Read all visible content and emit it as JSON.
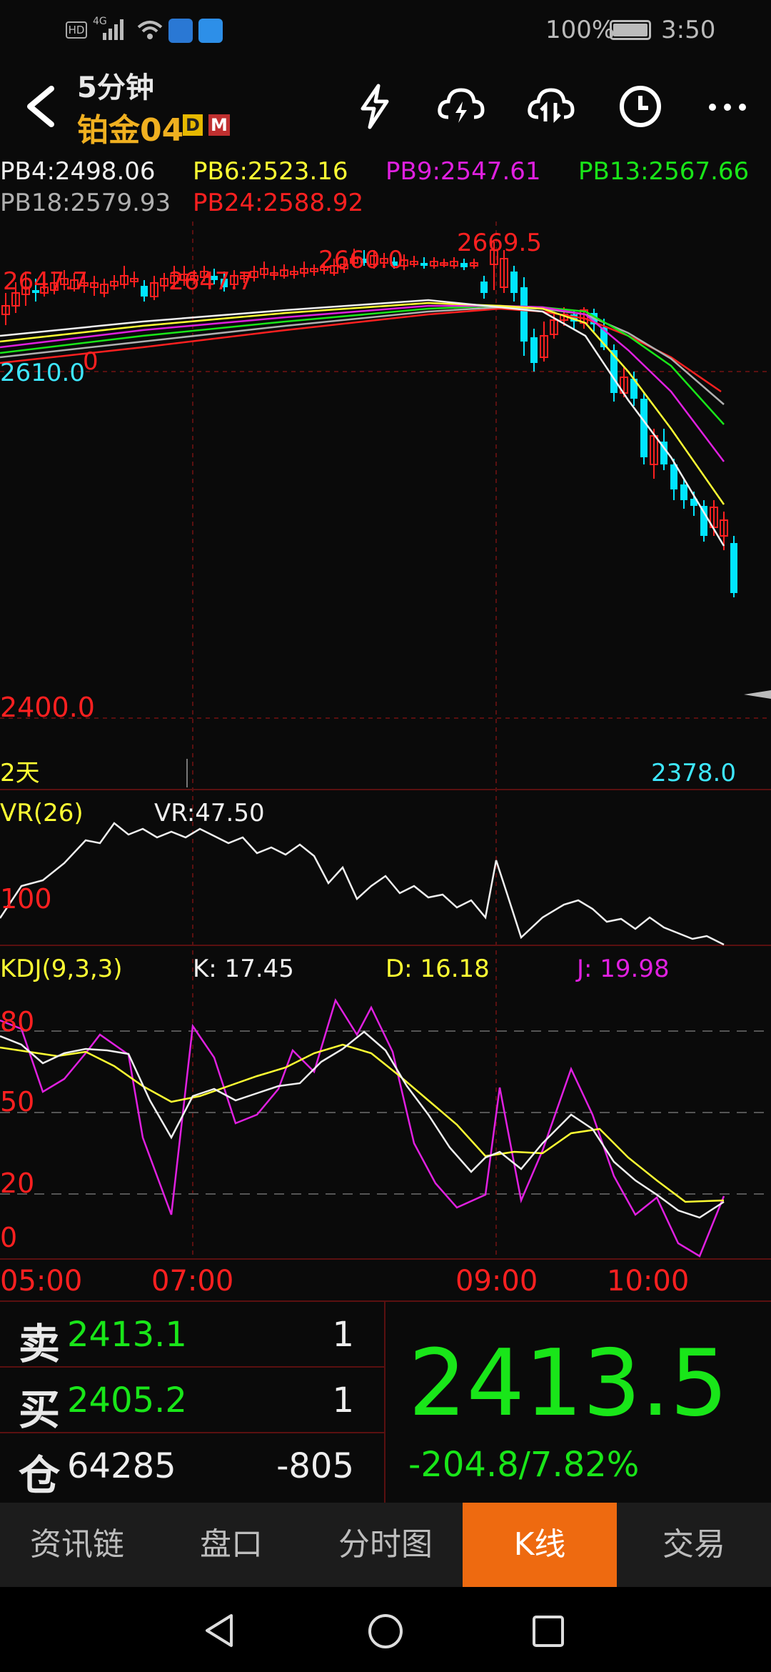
{
  "status": {
    "battery": "100%",
    "time": "3:50",
    "hd": "HD",
    "net": "4G"
  },
  "header": {
    "period": "5分钟",
    "instrument": "铂金04",
    "badge_d": "D",
    "badge_m": "M"
  },
  "ma": {
    "pb4": "PB4:2498.06",
    "pb6": "PB6:2523.16",
    "pb9": "PB9:2547.61",
    "pb13": "PB13:2567.66",
    "pb18": "PB18:2579.93",
    "pb24": "PB24:2588.92"
  },
  "main": {
    "p1": "2647.7",
    "p2": "2647.7",
    "p3": "2660.0",
    "p4": "2669.5",
    "left_top": "2610.0",
    "left_mid": "0",
    "low_label": "2400.0",
    "days": "2天",
    "min_label": "2378.0"
  },
  "vr": {
    "title": "VR(26)",
    "value": "VR:47.50",
    "level": "100"
  },
  "kdj": {
    "title": "KDJ(9,3,3)",
    "k": "K: 17.45",
    "d": "D: 16.18",
    "j": "J: 19.98",
    "l80": "80",
    "l50": "50",
    "l20": "20",
    "l0": "0"
  },
  "time_axis": {
    "t1": "05:00",
    "t2": "07:00",
    "t3": "09:00",
    "t4": "10:00"
  },
  "quote": {
    "sell_label": "卖",
    "sell_price": "2413.1",
    "sell_qty": "1",
    "buy_label": "买",
    "buy_price": "2405.2",
    "buy_qty": "1",
    "oi_label": "仓",
    "oi_value": "64285",
    "oi_change": "-805",
    "last": "2413.5",
    "change": "-204.8/7.82%"
  },
  "tabs": {
    "t1": "资讯链",
    "t2": "盘口",
    "t3": "分时图",
    "t4": "K线",
    "t5": "交易"
  },
  "colors": {
    "up": "#ff2020",
    "down": "#00e5ff",
    "green": "#19e619",
    "yellow": "#ffff33",
    "magenta": "#e020e0",
    "orange": "#ee6a10"
  }
}
